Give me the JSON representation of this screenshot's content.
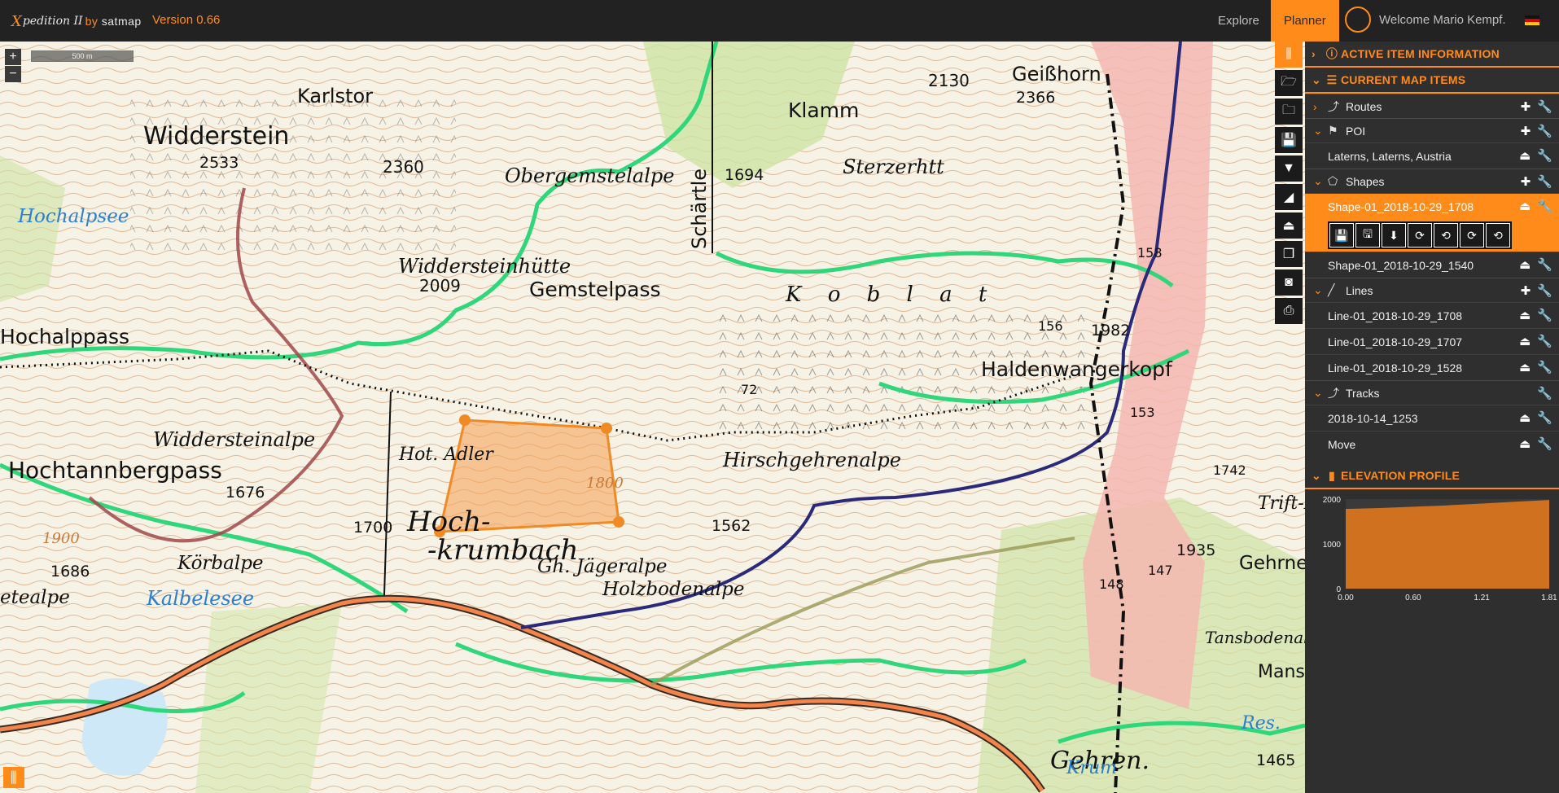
{
  "topbar": {
    "logo": {
      "part1": "X",
      "part2": "pedition II",
      "part3_prefix": "by",
      "part3": "satmap"
    },
    "version": "Version 0.66",
    "nav": {
      "explore": "Explore",
      "planner": "Planner"
    },
    "welcome": "Welcome Mario Kempf.",
    "language_flag": "german-flag-icon",
    "colors": {
      "accent": "#ff8c1a",
      "bar": "#222222"
    }
  },
  "map": {
    "zoom_in": "+",
    "zoom_out": "−",
    "scale_label": "500 m",
    "labels": {
      "karlstor": "Karlstor",
      "widderstein": "Widderstein",
      "widderstein_elev": "2533",
      "spot_2360": "2360",
      "hochalpsee": "Hochalpsee",
      "widdersteinhuette": "Widdersteinhütte",
      "widdersteinhuette_elev": "2009",
      "gemstelpass": "Gemstelpass",
      "hochalppass": "Hochalppass",
      "widdersteinalpe": "Widdersteinalpe",
      "hochtannbergpass": "Hochtannbergpass",
      "elev_1676": "1676",
      "hot_adler": "Hot. Adler",
      "elev_1700": "1700",
      "hoch": "Hoch-",
      "krumbach": "-krumbach",
      "elev_1686": "1686",
      "koerbalpe": "Körbalpe",
      "kalbelesee": "Kalbelesee",
      "etealpe": "etealpe",
      "jaegeralpe": "Gh. Jägeralpe",
      "holzbodenalpe": "Holzbodenalpe",
      "elev_1562": "1562",
      "hirschgehrenalpe": "Hirschgehrenalpe",
      "haldenwangerkopf": "Haldenwangerkopf",
      "kobl": "K o b l a t",
      "schaertle": "Schärtle",
      "obergemstelalpe": "Obergemstelalpe",
      "elev_1694": "1694",
      "sterzerhtt": "Sterzerhtt",
      "klamm": "Klamm",
      "elev_2130": "2130",
      "geisshorn": "Geißhorn",
      "geisshorn_elev": "2366",
      "elev_1982": "1982",
      "elev_1935": "1935",
      "gehrener": "Gehrner",
      "gehren": "Gehren.",
      "elev_1465": "1465",
      "elev_1800": "1800",
      "elev_1900": "1900",
      "trift": "Trift-H",
      "mansg": "Mansg",
      "res": "Res.",
      "krum": "Krum",
      "tansboden": "Tansbodenalpe",
      "n_158": "158",
      "n_156": "156",
      "n_153": "153",
      "n_148": "148",
      "n_147": "147",
      "n_72": "72",
      "n_1742": "1742"
    }
  },
  "toolbar": {
    "buttons": [
      "panel-toggle-icon",
      "folder-open-icon",
      "folder-icon",
      "save-icon",
      "place-poi-icon",
      "elevation-icon",
      "pin-upload-icon",
      "copy-icon",
      "camera-icon",
      "print-icon"
    ]
  },
  "panel": {
    "active_item_title": "ACTIVE ITEM INFORMATION",
    "current_items_title": "CURRENT MAP ITEMS",
    "groups": {
      "routes": {
        "label": "Routes"
      },
      "poi": {
        "label": "POI",
        "items": [
          "Laterns, Laterns, Austria"
        ]
      },
      "shapes": {
        "label": "Shapes",
        "items": [
          "Shape-01_2018-10-29_1708",
          "Shape-01_2018-10-29_1540"
        ]
      },
      "lines": {
        "label": "Lines",
        "items": [
          "Line-01_2018-10-29_1708",
          "Line-01_2018-10-29_1707",
          "Line-01_2018-10-29_1528"
        ]
      },
      "tracks": {
        "label": "Tracks",
        "items": [
          "2018-10-14_1253",
          "Move"
        ]
      }
    },
    "shape_tools": [
      "save-icon",
      "save-as-icon",
      "download-icon",
      "rotate-icon-1",
      "rotate-icon-2",
      "rotate-icon-3",
      "rotate-icon-4"
    ],
    "elevation_title": "ELEVATION PROFILE"
  },
  "chart_data": {
    "type": "area",
    "title": "ELEVATION PROFILE",
    "x": [
      0.0,
      0.3,
      0.6,
      0.9,
      1.21,
      1.5,
      1.81
    ],
    "values": [
      1780,
      1800,
      1830,
      1860,
      1900,
      1940,
      1980
    ],
    "xticks": [
      "0.00",
      "0.60",
      "1.21",
      "1.81"
    ],
    "yticks": [
      "2000",
      "1000",
      "0"
    ],
    "xlim": [
      0,
      1.81
    ],
    "ylim": [
      0,
      2000
    ],
    "fill_color": "#e0781c"
  }
}
